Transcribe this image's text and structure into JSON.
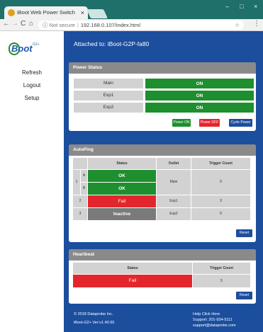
{
  "browser": {
    "tab_title": "iBoot Web Power Switch",
    "tab_close": "×",
    "win_min": "–",
    "win_max": "□",
    "win_close": "×",
    "back": "←",
    "forward": "→",
    "reload": "C",
    "home": "⌂",
    "security_label": "Not secure",
    "url": "192.168.0.107/index.html",
    "zoom_icon": "🔍",
    "star": "☆",
    "menu": "⋮"
  },
  "logo": {
    "text": "Boot",
    "superscript": "G2+"
  },
  "sidebar": {
    "items": [
      {
        "label": "Refresh"
      },
      {
        "label": "Logout"
      },
      {
        "label": "Setup"
      }
    ]
  },
  "attached": "Attached to: iBoot-G2P-fa80",
  "power_status": {
    "title": "Power Status",
    "rows": [
      {
        "name": "Main",
        "state": "ON"
      },
      {
        "name": "Exp1",
        "state": "ON"
      },
      {
        "name": "Exp2",
        "state": "ON"
      }
    ],
    "buttons": {
      "power_on": "Power ON",
      "power_off": "Power OFF",
      "cycle": "Cycle Power"
    }
  },
  "autoping": {
    "title": "AutoPing",
    "headers": {
      "status": "Status",
      "outlet": "Outlet",
      "trigger": "Trigger Count"
    },
    "rows": [
      {
        "num": "1",
        "sub": "A",
        "status": "OK",
        "outlet": "Main",
        "trigger": "0"
      },
      {
        "num": "",
        "sub": "B",
        "status": "OK",
        "outlet": "",
        "trigger": ""
      },
      {
        "num": "2",
        "sub": "",
        "status": "Fail",
        "outlet": "Exp1",
        "trigger": "3"
      },
      {
        "num": "3",
        "sub": "",
        "status": "Inactive",
        "outlet": "Exp2",
        "trigger": "0"
      }
    ],
    "reset": "Reset"
  },
  "heartbeat": {
    "title": "Heartbeat",
    "headers": {
      "status": "Status",
      "trigger": "Trigger Count"
    },
    "status": "Fail",
    "trigger": "5",
    "reset": "Reset"
  },
  "footer": {
    "copyright": "© 2018 Dataprobe Inc.",
    "version": "iBoot-G2+ Ver:v1.40.60",
    "help": "Help Click Here",
    "support_phone": "Support: 201-934-5111",
    "support_email": "support@dataprobe.com"
  },
  "colors": {
    "green": "#1e8f2e",
    "red": "#e3262d",
    "blue": "#1c4e9e",
    "gray": "#7a7a7a"
  }
}
